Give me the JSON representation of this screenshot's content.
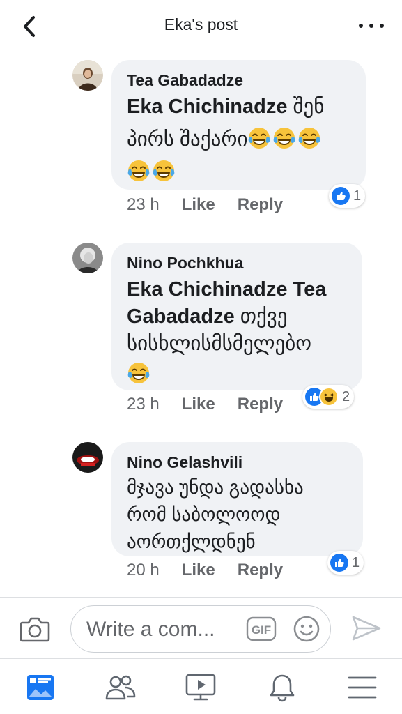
{
  "header": {
    "title": "Eka's post"
  },
  "comments": [
    {
      "author": "Tea Gabadadze",
      "mention": "Eka Chichinadze",
      "text": " შენ პირს შაქარი",
      "emoji_count": 5,
      "time": "23 h",
      "like_label": "Like",
      "reply_label": "Reply",
      "reaction_count": "1",
      "reactions": [
        "like"
      ]
    },
    {
      "author": "Nino Pochkhua",
      "mention": "Eka Chichinadze Tea Gabadadze",
      "text": " თქვე სისხლისმსმელებო",
      "emoji_count": 1,
      "time": "23 h",
      "like_label": "Like",
      "reply_label": "Reply",
      "reaction_count": "2",
      "reactions": [
        "like",
        "haha"
      ]
    },
    {
      "author": "Nino Gelashvili",
      "mention": "",
      "text": "მჯავა უნდა გადასხა რომ საბოლოოდ აორთქლდნენ",
      "emoji_count": 0,
      "time": "20 h",
      "like_label": "Like",
      "reply_label": "Reply",
      "reaction_count": "1",
      "reactions": [
        "like"
      ]
    }
  ],
  "composer": {
    "placeholder": "Write a com..."
  },
  "nav": {
    "items": [
      "news-feed-icon",
      "friends-icon",
      "watch-icon",
      "notifications-icon",
      "menu-icon"
    ]
  },
  "colors": {
    "accent": "#1877f2",
    "bubble": "#f0f2f5",
    "meta_text": "#65676b",
    "haha": "#f7c33b"
  }
}
